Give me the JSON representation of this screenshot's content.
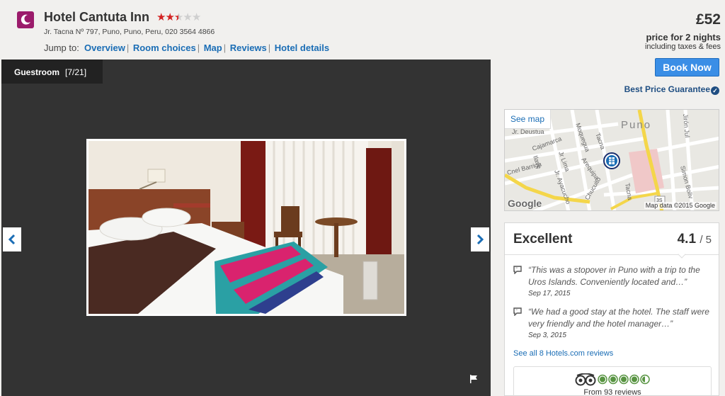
{
  "header": {
    "hotel_name": "Hotel Cantuta Inn",
    "star_rating": 2.5,
    "star_max": 5,
    "address": "Jr. Tacna Nº 797, Puno, Puno, Peru, 020 3564 4866",
    "jump_label": "Jump to:",
    "jump_links": [
      "Overview",
      "Room choices",
      "Map",
      "Reviews",
      "Hotel details"
    ]
  },
  "pricing": {
    "price": "£52",
    "price_for": "price for 2 nights",
    "including": "including taxes & fees",
    "book_label": "Book Now",
    "guarantee": "Best Price Guarantee"
  },
  "gallery": {
    "label": "Guestroom",
    "counter": "[7/21]",
    "prev_icon": "chevron-left-icon",
    "next_icon": "chevron-right-icon"
  },
  "map": {
    "see_map": "See map",
    "city_label": "Puno",
    "streets": [
      "Jr. Deustua",
      "Cajamarca",
      "Jr Lima",
      "Moquegua",
      "Tacna",
      "Jirón Jul",
      "Cnel Barriga",
      "Jr. Ayacucho",
      "Arequipa",
      "Ilave",
      "Chucuito",
      "Tacna",
      "Simon Boliv"
    ],
    "road_shield": "3S",
    "logo": "Google",
    "attribution": "Map data ©2015 Google"
  },
  "reviews": {
    "rating_word": "Excellent",
    "score": "4.1",
    "out_of": "/ 5",
    "items": [
      {
        "text": "“This was a stopover in Puno with a trip to the Uros Islands. Conveniently located and…”",
        "date": "Sep 17, 2015"
      },
      {
        "text": "“We had a good stay at the hotel. The staff were very friendly and the hotel manager…”",
        "date": "Sep 3, 2015"
      }
    ],
    "see_all": "See all 8 Hotels.com reviews",
    "tripadvisor": {
      "bubbles": 4.5,
      "count_text": "From 93 reviews"
    }
  },
  "colors": {
    "link": "#1a6db5",
    "book_button": "#3a8ee6",
    "brand": "#9b1b6b",
    "star": "#d32222",
    "tripadvisor_green": "#589442"
  }
}
